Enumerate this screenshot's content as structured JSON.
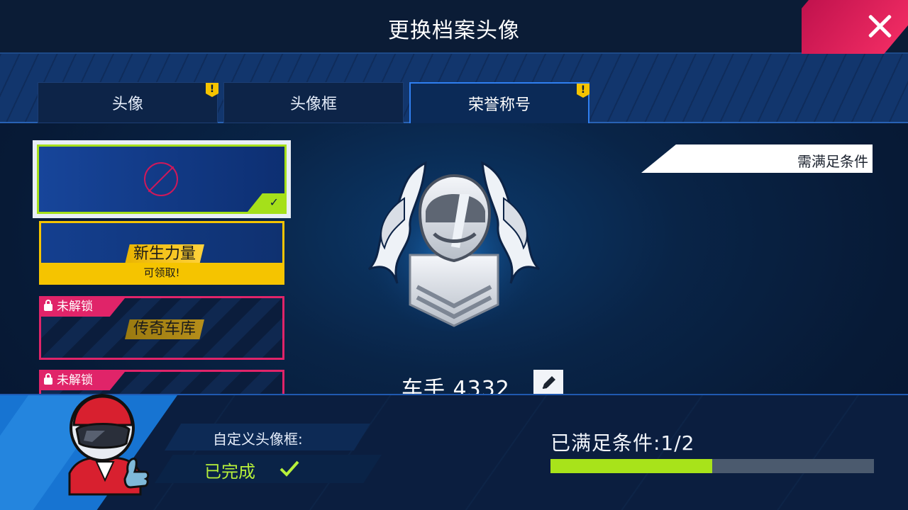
{
  "header": {
    "title": "更换档案头像",
    "close_label": "close"
  },
  "tabs": [
    {
      "label": "头像",
      "warn": "!"
    },
    {
      "label": "头像框",
      "warn": ""
    },
    {
      "label": "荣誉称号",
      "warn": "!"
    }
  ],
  "active_tab": "荣誉称号",
  "list": {
    "selected_check": "✓",
    "gold_card": {
      "title": "新生力量",
      "claim_label": "可领取!"
    },
    "locked_cards": [
      {
        "lock_label": "未解锁",
        "title": "传奇车库"
      },
      {
        "lock_label": "未解锁"
      }
    ]
  },
  "detail": {
    "requirement_label": "需满足条件",
    "player_name": "车手 4332"
  },
  "bottom": {
    "condition_label": "自定义头像框:",
    "status_label": "已完成",
    "progress_title": "已满足条件:1/2",
    "progress_fraction": 0.5
  },
  "colors": {
    "accent_green": "#a8e31a",
    "accent_gold": "#f5c400",
    "accent_pink": "#e02469",
    "close_red": "#ee2a62"
  },
  "icons": [
    "close-icon",
    "warning-icon",
    "no-selection-icon",
    "check-icon",
    "lock-icon",
    "edit-pencil-icon",
    "helmet-emblem-icon",
    "racer-avatar-icon"
  ]
}
